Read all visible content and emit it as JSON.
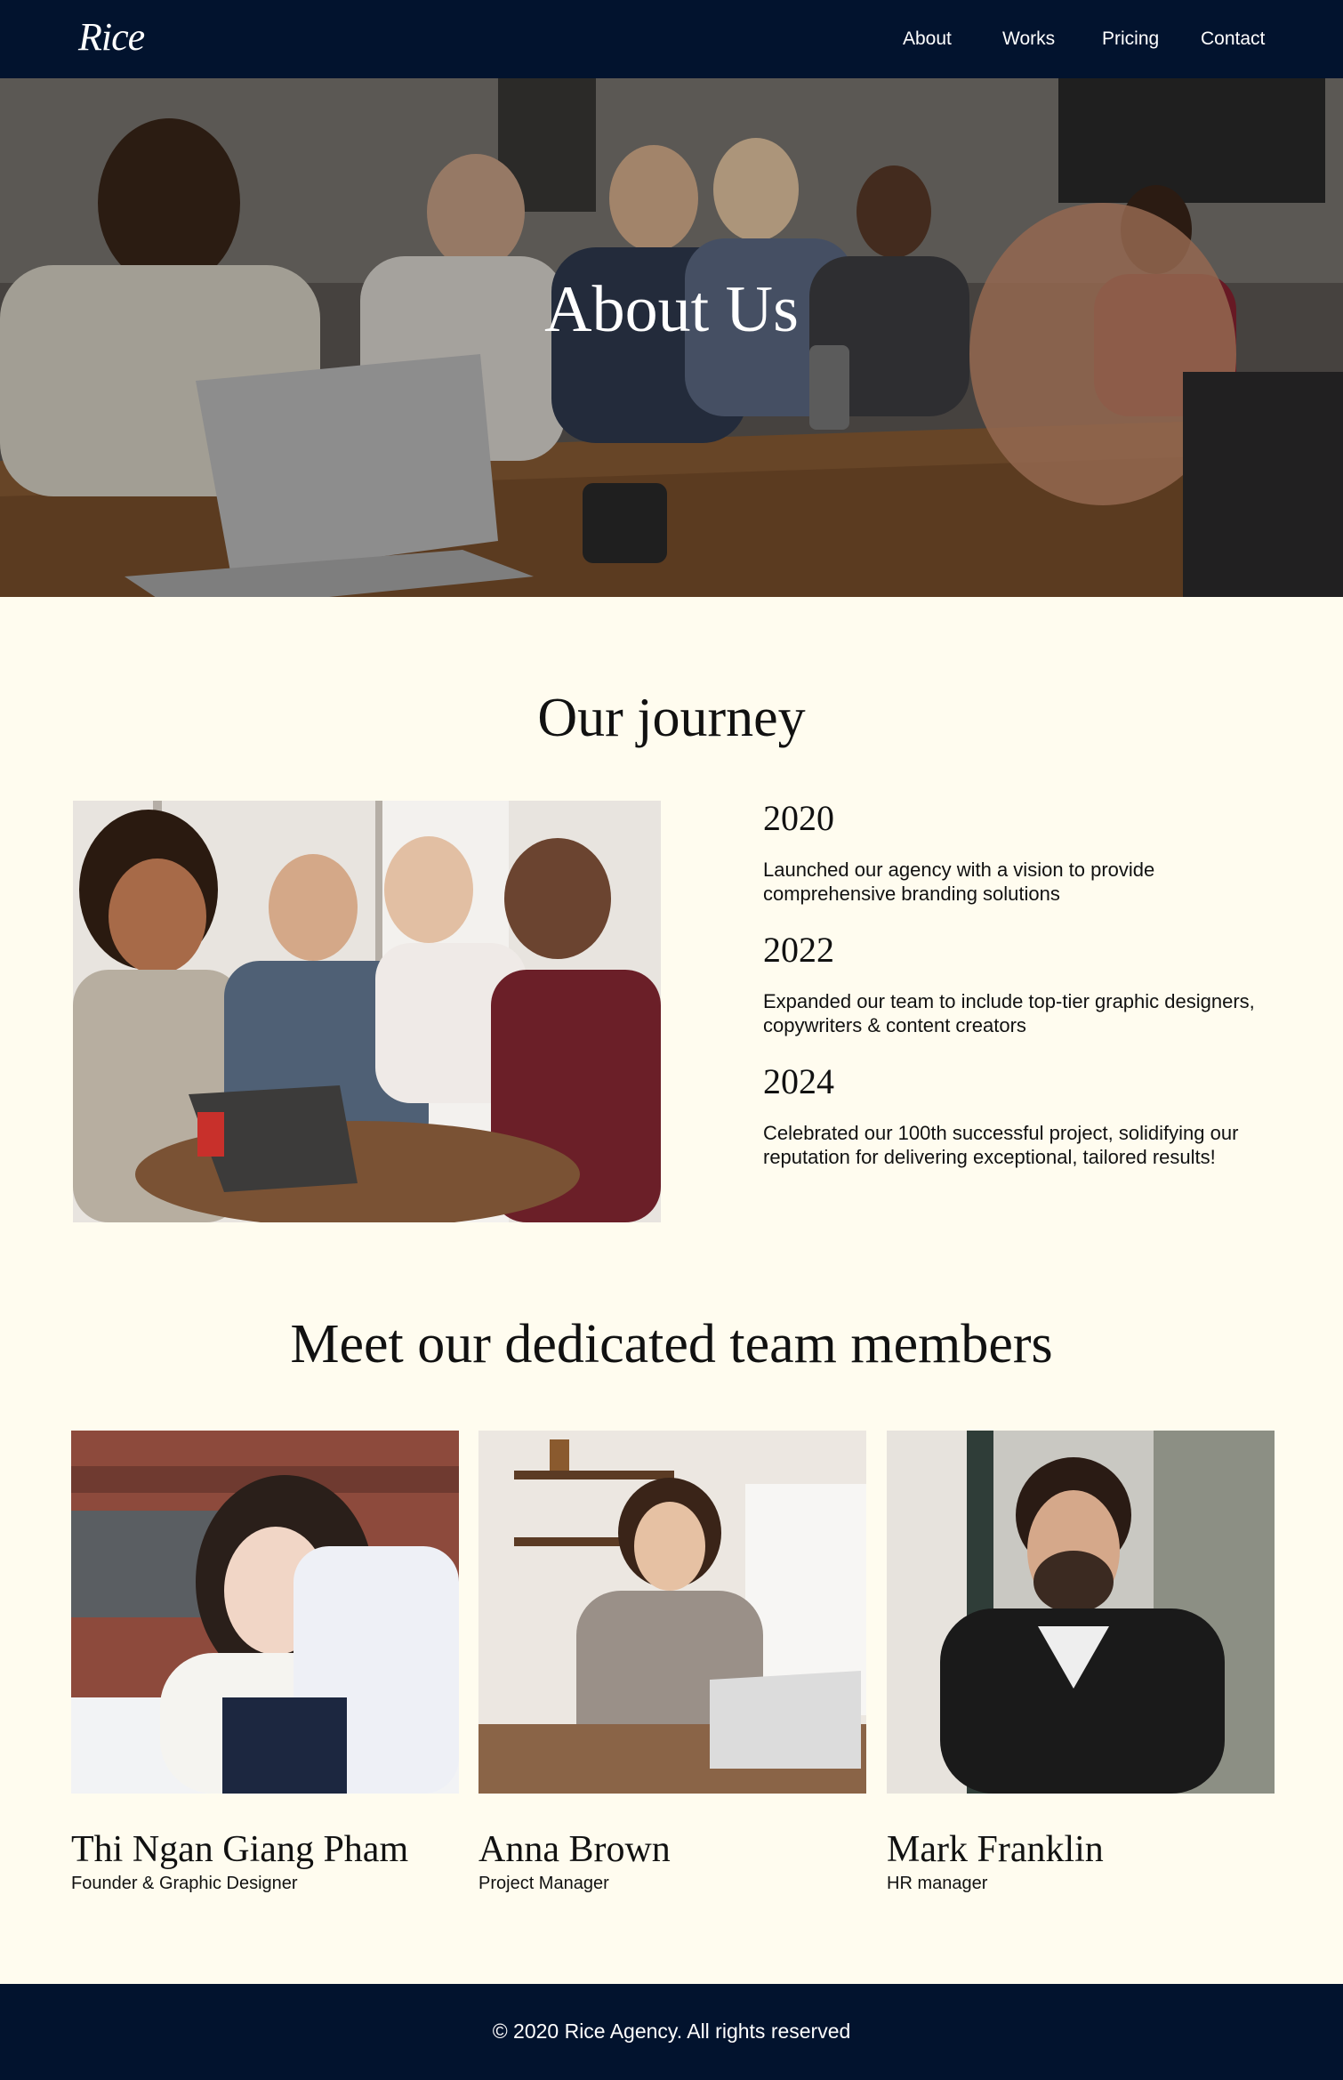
{
  "nav": {
    "logo": "Rice",
    "links": [
      {
        "label": "About"
      },
      {
        "label": "Works"
      },
      {
        "label": "Pricing"
      },
      {
        "label": "Contact"
      }
    ]
  },
  "hero": {
    "title": "About Us"
  },
  "journey": {
    "title": "Our journey",
    "milestones": [
      {
        "year": "2020",
        "text": "Launched our agency with a vision to provide comprehensive branding solutions"
      },
      {
        "year": "2022",
        "text": "Expanded our team to include top-tier graphic designers, copywriters & content creators"
      },
      {
        "year": "2024",
        "text": "Celebrated our 100th successful project, solidifying our reputation for delivering exceptional, tailored results!"
      }
    ]
  },
  "team": {
    "title": "Meet our dedicated team members",
    "members": [
      {
        "name": "Thi Ngan Giang Pham",
        "role": "Founder & Graphic Designer"
      },
      {
        "name": "Anna Brown",
        "role": "Project Manager"
      },
      {
        "name": "Mark Franklin",
        "role": "HR manager"
      }
    ]
  },
  "footer": {
    "text": "© 2020 Rice Agency. All rights reserved"
  },
  "colors": {
    "nav_bg": "#02132e",
    "page_bg": "#fffcef",
    "text": "#111111"
  }
}
